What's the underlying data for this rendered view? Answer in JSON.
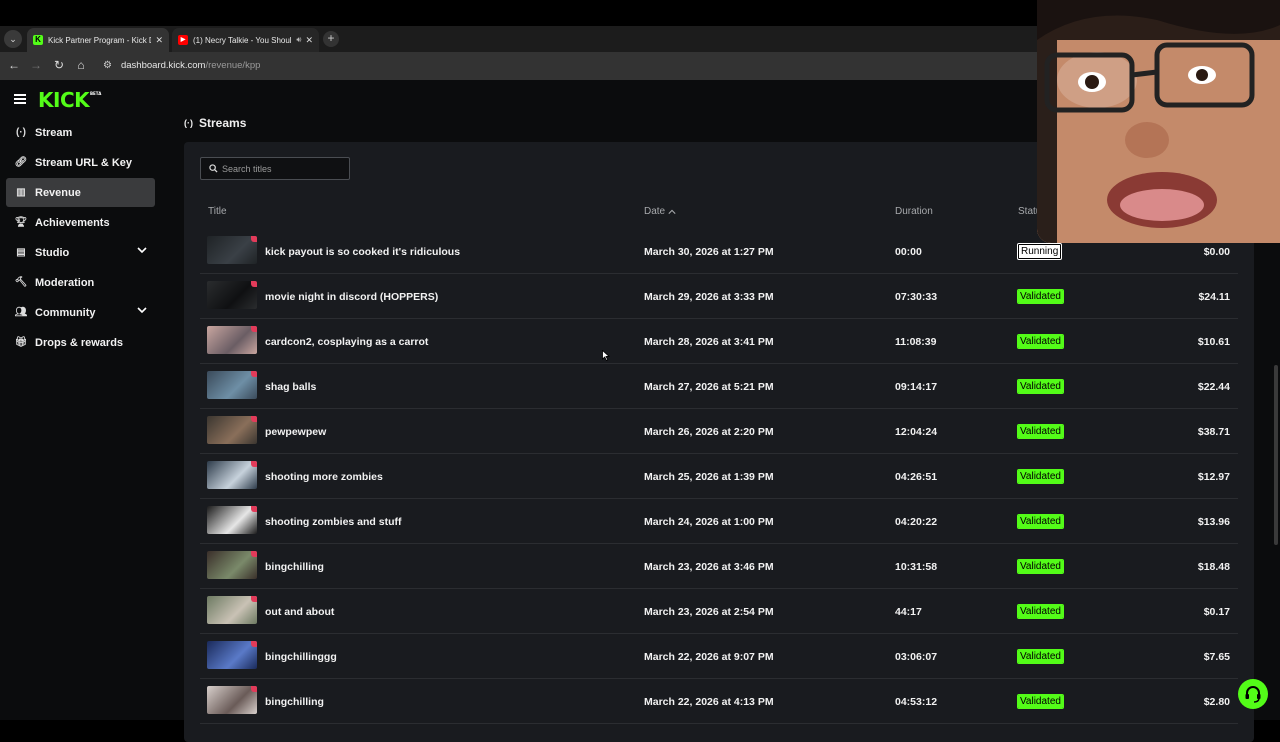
{
  "browser": {
    "tabs": [
      {
        "title": "Kick Partner Program - Kick Da",
        "favicon": "kick-favicon",
        "color": "#53fc18"
      },
      {
        "title": "(1) Necry Talkie - You Shoul",
        "favicon": "youtube-favicon",
        "color": "#ff0000"
      }
    ],
    "url_host": "dashboard.kick.com",
    "url_path": "/revenue/kpp"
  },
  "sidebar": {
    "logo": "KICK",
    "logo_badge": "BETA",
    "items": [
      {
        "label": "Stream",
        "icon": "broadcast-icon"
      },
      {
        "label": "Stream URL & Key",
        "icon": "link-icon"
      },
      {
        "label": "Revenue",
        "icon": "bar-chart-icon",
        "active": true
      },
      {
        "label": "Achievements",
        "icon": "trophy-icon"
      },
      {
        "label": "Studio",
        "icon": "studio-icon",
        "expandable": true
      },
      {
        "label": "Moderation",
        "icon": "hammer-icon"
      },
      {
        "label": "Community",
        "icon": "users-icon",
        "expandable": true
      },
      {
        "label": "Drops & rewards",
        "icon": "gift-icon"
      }
    ]
  },
  "main": {
    "section_title": "Streams",
    "search_placeholder": "Search titles",
    "columns": {
      "title": "Title",
      "date": "Date",
      "duration": "Duration",
      "status": "Status"
    },
    "rows": [
      {
        "title": "kick payout is so cooked it's ridiculous",
        "date": "March 30, 2026 at 1:27 PM",
        "duration": "00:00",
        "status": "Running",
        "amount": "$0.00"
      },
      {
        "title": "movie night in discord (HOPPERS)",
        "date": "March 29, 2026 at 3:33 PM",
        "duration": "07:30:33",
        "status": "Validated",
        "amount": "$24.11"
      },
      {
        "title": "cardcon2, cosplaying as a carrot",
        "date": "March 28, 2026 at 3:41 PM",
        "duration": "11:08:39",
        "status": "Validated",
        "amount": "$10.61"
      },
      {
        "title": "shag balls",
        "date": "March 27, 2026 at 5:21 PM",
        "duration": "09:14:17",
        "status": "Validated",
        "amount": "$22.44"
      },
      {
        "title": "pewpewpew",
        "date": "March 26, 2026 at 2:20 PM",
        "duration": "12:04:24",
        "status": "Validated",
        "amount": "$38.71"
      },
      {
        "title": "shooting more zombies",
        "date": "March 25, 2026 at 1:39 PM",
        "duration": "04:26:51",
        "status": "Validated",
        "amount": "$12.97"
      },
      {
        "title": "shooting zombies and stuff",
        "date": "March 24, 2026 at 1:00 PM",
        "duration": "04:20:22",
        "status": "Validated",
        "amount": "$13.96"
      },
      {
        "title": "bingchilling",
        "date": "March 23, 2026 at 3:46 PM",
        "duration": "10:31:58",
        "status": "Validated",
        "amount": "$18.48"
      },
      {
        "title": "out and about",
        "date": "March 23, 2026 at 2:54 PM",
        "duration": "44:17",
        "status": "Validated",
        "amount": "$0.17"
      },
      {
        "title": "bingchillinggg",
        "date": "March 22, 2026 at 9:07 PM",
        "duration": "03:06:07",
        "status": "Validated",
        "amount": "$7.65"
      },
      {
        "title": "bingchilling",
        "date": "March 22, 2026 at 4:13 PM",
        "duration": "04:53:12",
        "status": "Validated",
        "amount": "$2.80"
      }
    ]
  },
  "colors": {
    "accent": "#53fc18",
    "panel": "#191b1f",
    "background": "#0b0c0d"
  }
}
